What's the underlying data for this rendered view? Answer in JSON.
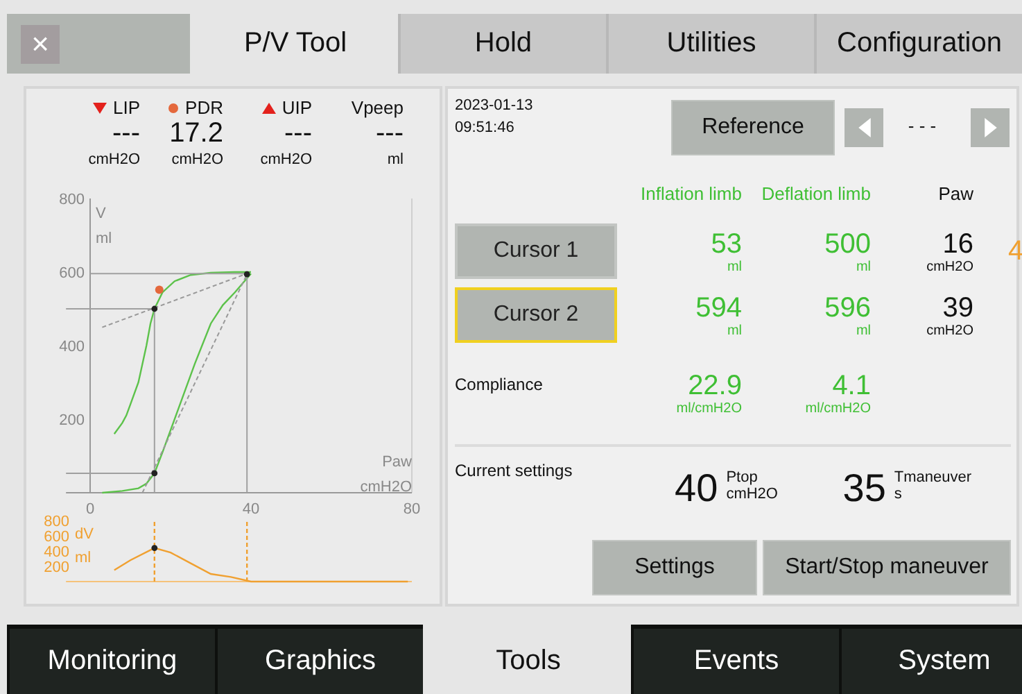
{
  "close_button": {
    "label": "×"
  },
  "top_tabs": [
    {
      "label": "P/V Tool",
      "selected": true
    },
    {
      "label": "Hold",
      "selected": false
    },
    {
      "label": "Utilities",
      "selected": false
    },
    {
      "label": "Configuration",
      "selected": false
    }
  ],
  "readouts": [
    {
      "label": "LIP",
      "kind": "triangle-down",
      "color": "#e3211c",
      "value": "---",
      "unit": "cmH2O"
    },
    {
      "label": "PDR",
      "kind": "dot",
      "color": "#e4683c",
      "value": "17.2",
      "unit": "cmH2O"
    },
    {
      "label": "UIP",
      "kind": "triangle-up",
      "color": "#e3211c",
      "value": "---",
      "unit": "cmH2O"
    },
    {
      "label": "Vpeep",
      "kind": "none",
      "value": "---",
      "unit": "ml"
    }
  ],
  "pv_chart": {
    "y_unit": "ml",
    "x_unit": "cmH2O",
    "chart_data": {
      "type": "line",
      "xlabel": "Paw",
      "ylabel": "V",
      "xlim": [
        -6,
        80
      ],
      "ylim": [
        0,
        800
      ],
      "xticks": [
        0,
        40,
        80
      ],
      "yticks": [
        200,
        400,
        600,
        800
      ],
      "series": [
        {
          "color": "#5cc24a",
          "x": [
            3,
            8,
            12,
            14,
            16,
            18,
            22,
            26,
            30,
            33,
            36,
            38,
            40
          ],
          "values": [
            0,
            5,
            12,
            25,
            53,
            110,
            230,
            350,
            460,
            510,
            545,
            570,
            596
          ]
        },
        {
          "color": "#5cc24a",
          "x": [
            40,
            36,
            30,
            25,
            21,
            18,
            16,
            15,
            14,
            12,
            11,
            10,
            9,
            8,
            6
          ],
          "values": [
            600,
            600,
            598,
            592,
            575,
            545,
            500,
            460,
            400,
            300,
            270,
            240,
            210,
            190,
            160
          ]
        },
        {
          "color": "#a0a0a0",
          "x": [
            16,
            16
          ],
          "values": [
            0,
            500
          ]
        },
        {
          "color": "#a0a0a0",
          "x": [
            39,
            39
          ],
          "values": [
            0,
            596
          ]
        },
        {
          "color": "#a0a0a0",
          "x": [
            0,
            39
          ],
          "values": [
            596,
            596
          ]
        },
        {
          "color": "#a0a0a0",
          "x": [
            -6,
            16
          ],
          "values": [
            500,
            500
          ]
        },
        {
          "color": "#a0a0a0",
          "x": [
            -6,
            16
          ],
          "values": [
            53,
            53
          ]
        },
        {
          "color": "#999999",
          "line_style": "dashed",
          "x": [
            3,
            39
          ],
          "values": [
            450,
            596
          ]
        },
        {
          "color": "#999999",
          "line_style": "dashed",
          "x": [
            13,
            39
          ],
          "values": [
            0,
            594
          ]
        }
      ]
    }
  },
  "dv_chart": {
    "y_unit": "ml",
    "chart_data": {
      "type": "line",
      "ylabel": "dV",
      "xlim": [
        -6,
        80
      ],
      "ylim": [
        0,
        800
      ],
      "yticks": [
        200,
        400,
        600,
        800
      ],
      "series": [
        {
          "color": "#f0a030",
          "x": [
            6,
            10,
            16,
            20,
            25,
            30,
            35,
            40,
            79
          ],
          "values": [
            150,
            280,
            440,
            380,
            240,
            100,
            60,
            0,
            0
          ]
        },
        {
          "color": "#f0a030",
          "line_style": "dashed",
          "x": [
            16,
            16
          ],
          "values": [
            0,
            800
          ]
        },
        {
          "color": "#f0a030",
          "line_style": "dashed",
          "x": [
            39,
            39
          ],
          "values": [
            0,
            800
          ]
        }
      ]
    }
  },
  "timestamp": {
    "date": "2023-01-13",
    "time": "09:51:46"
  },
  "reference_button": "Reference",
  "reference_value": "- - -",
  "columns": [
    {
      "label": "Inflation limb",
      "color": "#3fbf34"
    },
    {
      "label": "Deflation limb",
      "color": "#3fbf34"
    },
    {
      "label": "Paw",
      "color": "#111111"
    }
  ],
  "column_4_value": "4",
  "cursors": [
    {
      "label": "Cursor 1",
      "selected": false,
      "cells": [
        {
          "value": "53",
          "unit": "ml"
        },
        {
          "value": "500",
          "unit": "ml"
        },
        {
          "value": "16",
          "unit": "cmH2O"
        }
      ]
    },
    {
      "label": "Cursor 2",
      "selected": true,
      "cells": [
        {
          "value": "594",
          "unit": "ml"
        },
        {
          "value": "596",
          "unit": "ml"
        },
        {
          "value": "39",
          "unit": "cmH2O"
        }
      ]
    }
  ],
  "compliance": {
    "label": "Compliance",
    "cells": [
      {
        "value": "22.9",
        "unit": "ml/cmH2O"
      },
      {
        "value": "4.1",
        "unit": "ml/cmH2O"
      }
    ]
  },
  "current_settings": {
    "label": "Current settings",
    "items": [
      {
        "value": "40",
        "name": "Ptop",
        "unit": "cmH2O"
      },
      {
        "value": "35",
        "name": "Tmaneuver",
        "unit": "s"
      }
    ]
  },
  "buttons": [
    "Settings",
    "Start/Stop maneuver"
  ],
  "bottom_tabs": [
    {
      "label": "Monitoring",
      "selected": false
    },
    {
      "label": "Graphics",
      "selected": false
    },
    {
      "label": "Tools",
      "selected": true
    },
    {
      "label": "Events",
      "selected": false
    },
    {
      "label": "System",
      "selected": false
    }
  ]
}
